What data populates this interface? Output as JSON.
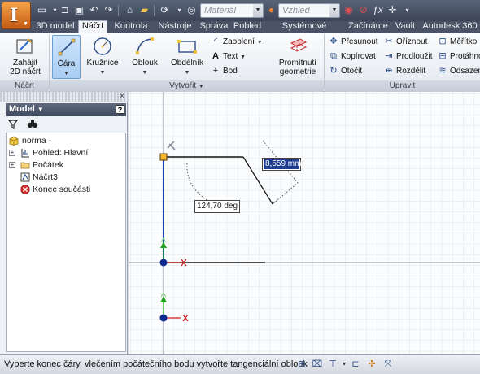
{
  "qat": {
    "material_placeholder": "Materiál",
    "appearance_placeholder": "Vzhled",
    "icons": [
      "new-file-icon",
      "open-icon",
      "save-icon",
      "undo-icon",
      "redo-icon",
      "home-icon",
      "project-icon",
      "update-icon",
      "select-icon",
      "material-icon",
      "appearance-icon",
      "clear-override-icon",
      "fx-icon",
      "add-icon"
    ]
  },
  "tabs": [
    {
      "label": "3D model"
    },
    {
      "label": "Náčrt",
      "active": true
    },
    {
      "label": "Kontrola"
    },
    {
      "label": "Nástroje"
    },
    {
      "label": "Správa"
    },
    {
      "label": "Pohled"
    },
    {
      "label": "Systémové prostředí"
    },
    {
      "label": "Začínáme"
    },
    {
      "label": "Vault"
    },
    {
      "label": "Autodesk 360"
    }
  ],
  "ribbon": {
    "sketch_panel": {
      "title": "Náčrt",
      "start_sketch": "Zahájit\n2D náčrt"
    },
    "create_panel": {
      "title": "Vytvořit",
      "line": "Čára",
      "circle": "Kružnice",
      "arc": "Oblouk",
      "rectangle": "Obdélník",
      "fillet": "Zaoblení",
      "text": "Text",
      "point": "Bod",
      "project_geometry": "Promítnutí\ngeometrie"
    },
    "modify_panel": {
      "title": "Upravit",
      "move": "Přesunout",
      "trim": "Oříznout",
      "scale": "Měřítko",
      "copy": "Kopírovat",
      "extend": "Prodloužit",
      "stretch": "Protáhno",
      "rotate": "Otočit",
      "split": "Rozdělit",
      "offset": "Odsazen"
    }
  },
  "browser": {
    "title": "Model",
    "help": "?",
    "tree": [
      {
        "label": "norma -",
        "icon": "part-icon",
        "indent": 0,
        "expander": false
      },
      {
        "label": "Pohled: Hlavní",
        "icon": "view-icon",
        "indent": 1,
        "expander": "+"
      },
      {
        "label": "Počátek",
        "icon": "folder-icon",
        "indent": 1,
        "expander": "+"
      },
      {
        "label": "Náčrt3",
        "icon": "sketch-icon",
        "indent": 1,
        "expander": false
      },
      {
        "label": "Konec součásti",
        "icon": "end-of-part-icon",
        "indent": 1,
        "expander": false
      }
    ]
  },
  "canvas": {
    "length_value": "8,559 mm",
    "angle_value": "124,70 deg"
  },
  "status": {
    "prompt": "Vyberte konec čáry, vlečením počátečního bodu vytvořte tangenciální oblouk"
  },
  "colors": {
    "accent": "#6a9fd6",
    "sketch_blue": "#1f3fbf",
    "axis_red": "#d22020",
    "axis_green": "#1fa31f",
    "point_orange": "#f3b32b"
  }
}
